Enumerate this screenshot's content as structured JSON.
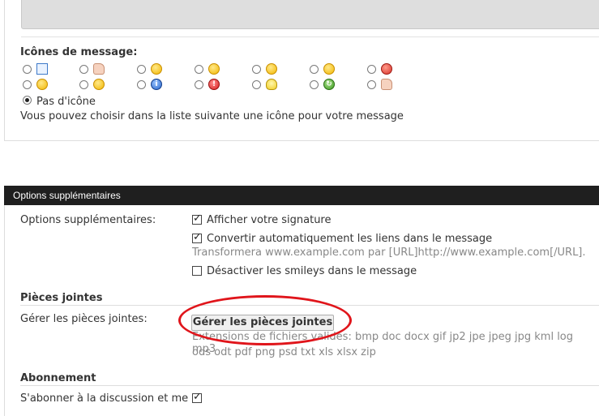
{
  "icons_section": {
    "title": "Icônes de message:",
    "no_icon_label": "Pas d'icône",
    "help_text": "Vous pouvez choisir dans la liste suivante une icône pour votre message",
    "icons": [
      "document-icon",
      "thumb-down-icon",
      "grin-icon",
      "smile-wink-icon",
      "laugh-icon",
      "sad-icon",
      "angry-icon",
      "smile-icon",
      "cool-icon",
      "info-icon",
      "exclamation-icon",
      "lightbulb-icon",
      "recycle-icon",
      "thumb-up-icon"
    ]
  },
  "options_section": {
    "header": "Options supplémentaires",
    "options_label": "Options supplémentaires:",
    "show_signature": "Afficher votre signature",
    "convert_links": "Convertir automatiquement les liens dans le message",
    "convert_links_hint": "Transformera www.example.com par [URL]http://www.example.com[/URL].",
    "disable_smilies": "Désactiver les smileys dans le message",
    "attachments_title": "Pièces jointes",
    "manage_label": "Gérer les pièces jointes:",
    "manage_button": "Gérer les pièces jointes",
    "valid_ext_line1": "Extensions de fichiers valides: bmp doc docx gif jp2 jpe jpeg jpg kml log mp3",
    "valid_ext_line2": "ods odt pdf png psd txt xls xlsx zip",
    "subscription_title": "Abonnement",
    "subscribe_label": "S'abonner à la discussion et me"
  },
  "colors": {
    "header_bg": "#1f1f1f",
    "highlight_ellipse": "#e0151b"
  }
}
